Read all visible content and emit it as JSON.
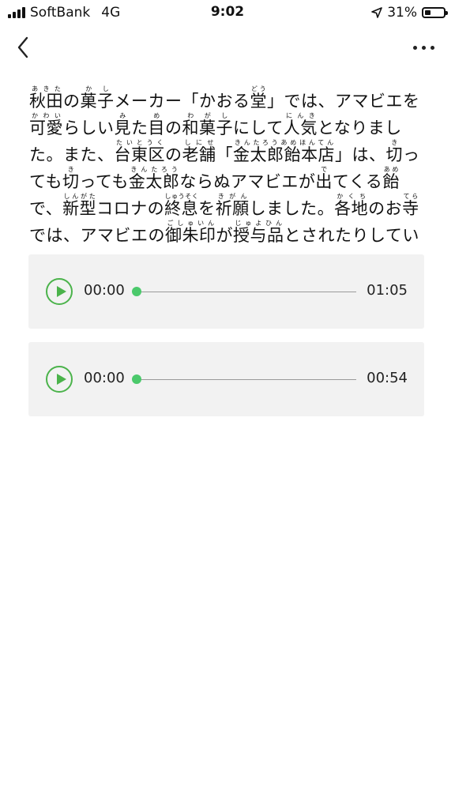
{
  "status_bar": {
    "carrier": "SoftBank",
    "network": "4G",
    "time": "9:02",
    "battery": "31%",
    "battery_level": 0.31
  },
  "nav": {
    "back_icon": "chevron-left-icon",
    "more_icon": "more-horizontal-icon"
  },
  "article": {
    "paragraph": "秋田の菓子メーカー「かおる堂」では、アマビエを可愛らしい見た目の和菓子にして人気となりました。また、台東区の老舗「金太郎飴本店」は、切っても切っても金太郎ならぬアマビエが出てくる飴で、新型コロナの終息を祈願しました。各地のお寺では、アマビエの御朱印が授与品とされたりしています。",
    "ruby_annotations": [
      "あきた",
      "かし",
      "どう",
      "かわい",
      "み",
      "め",
      "わがし",
      "にんき",
      "たいとうく",
      "しにせ",
      "きんたろうあめほんてん",
      "き",
      "き",
      "きんたろう",
      "で",
      "あめ",
      "しんがた",
      "しゅうそく",
      "きがん",
      "かくち",
      "てら",
      "ごしゅいん",
      "じゅよひん"
    ]
  },
  "players": [
    {
      "current_time": "00:00",
      "duration": "01:05",
      "progress": 0
    },
    {
      "current_time": "00:00",
      "duration": "00:54",
      "progress": 0
    }
  ],
  "colors": {
    "accent": "#4bb34b",
    "player_bg": "#f2f2f2"
  }
}
